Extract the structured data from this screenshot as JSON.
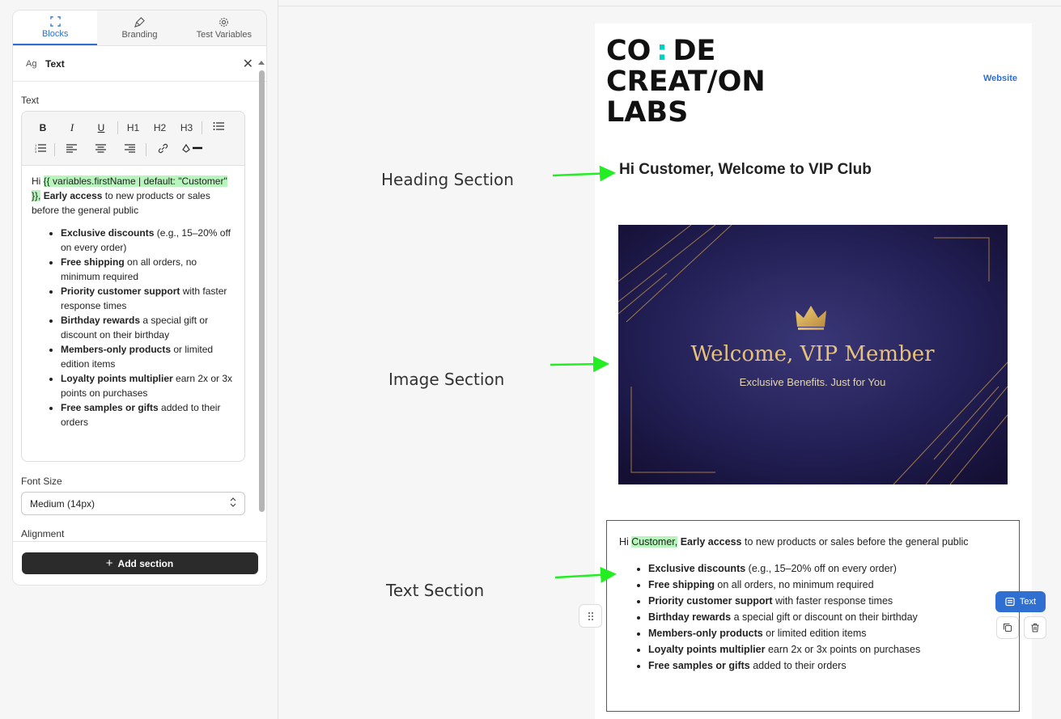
{
  "tabs": [
    {
      "label": "Blocks",
      "icon": "blocks-icon"
    },
    {
      "label": "Branding",
      "icon": "brush-icon"
    },
    {
      "label": "Test Variables",
      "icon": "gear-icon"
    }
  ],
  "block": {
    "icon_text": "Ag",
    "title": "Text"
  },
  "editor": {
    "label": "Text",
    "toolbar": {
      "bold": "B",
      "italic": "I",
      "underline": "U",
      "h1": "H1",
      "h2": "H2",
      "h3": "H3"
    },
    "content": {
      "greeting": "Hi ",
      "variable": "{{ variables.firstName | default: \"Customer\" }},",
      "bold_intro": " Early access",
      "intro_rest": " to new products or sales before the general public",
      "items": [
        {
          "bold": "Exclusive discounts",
          "rest": " (e.g., 15–20% off on every order)"
        },
        {
          "bold": "Free shipping",
          "rest": " on all orders, no minimum required"
        },
        {
          "bold": "Priority customer support",
          "rest": " with faster response times"
        },
        {
          "bold": "Birthday rewards",
          "rest": " a special gift or discount on their birthday"
        },
        {
          "bold": "Members-only products",
          "rest": " or limited edition items"
        },
        {
          "bold": "Loyalty points multiplier",
          "rest": " earn 2x or 3x points on purchases"
        },
        {
          "bold": "Free samples or gifts",
          "rest": " added to their orders"
        }
      ]
    }
  },
  "font_size": {
    "label": "Font Size",
    "value": "Medium (14px)"
  },
  "alignment": {
    "label": "Alignment"
  },
  "add_section": "Add section",
  "email": {
    "logo_lines": [
      "CO",
      "DE",
      "CREAT/ON",
      "LABS"
    ],
    "website_link": "Website",
    "heading": "Hi Customer, Welcome to VIP Club",
    "image": {
      "title": "Welcome, VIP Member",
      "subtitle": "Exclusive Benefits. Just for You"
    },
    "text_block": {
      "greeting": "Hi ",
      "variable": "Customer,",
      "bold_intro": " Early access",
      "intro_rest": " to new products or sales before the general public"
    },
    "selected_block_label": "Text"
  },
  "annotations": {
    "heading": "Heading Section",
    "image": "Image Section",
    "text": "Text Section"
  },
  "colors": {
    "accent": "#2f6fd1",
    "variable_highlight": "#b7f5bd",
    "logo_teal": "#00d1c4",
    "arrow": "#22ee22"
  }
}
